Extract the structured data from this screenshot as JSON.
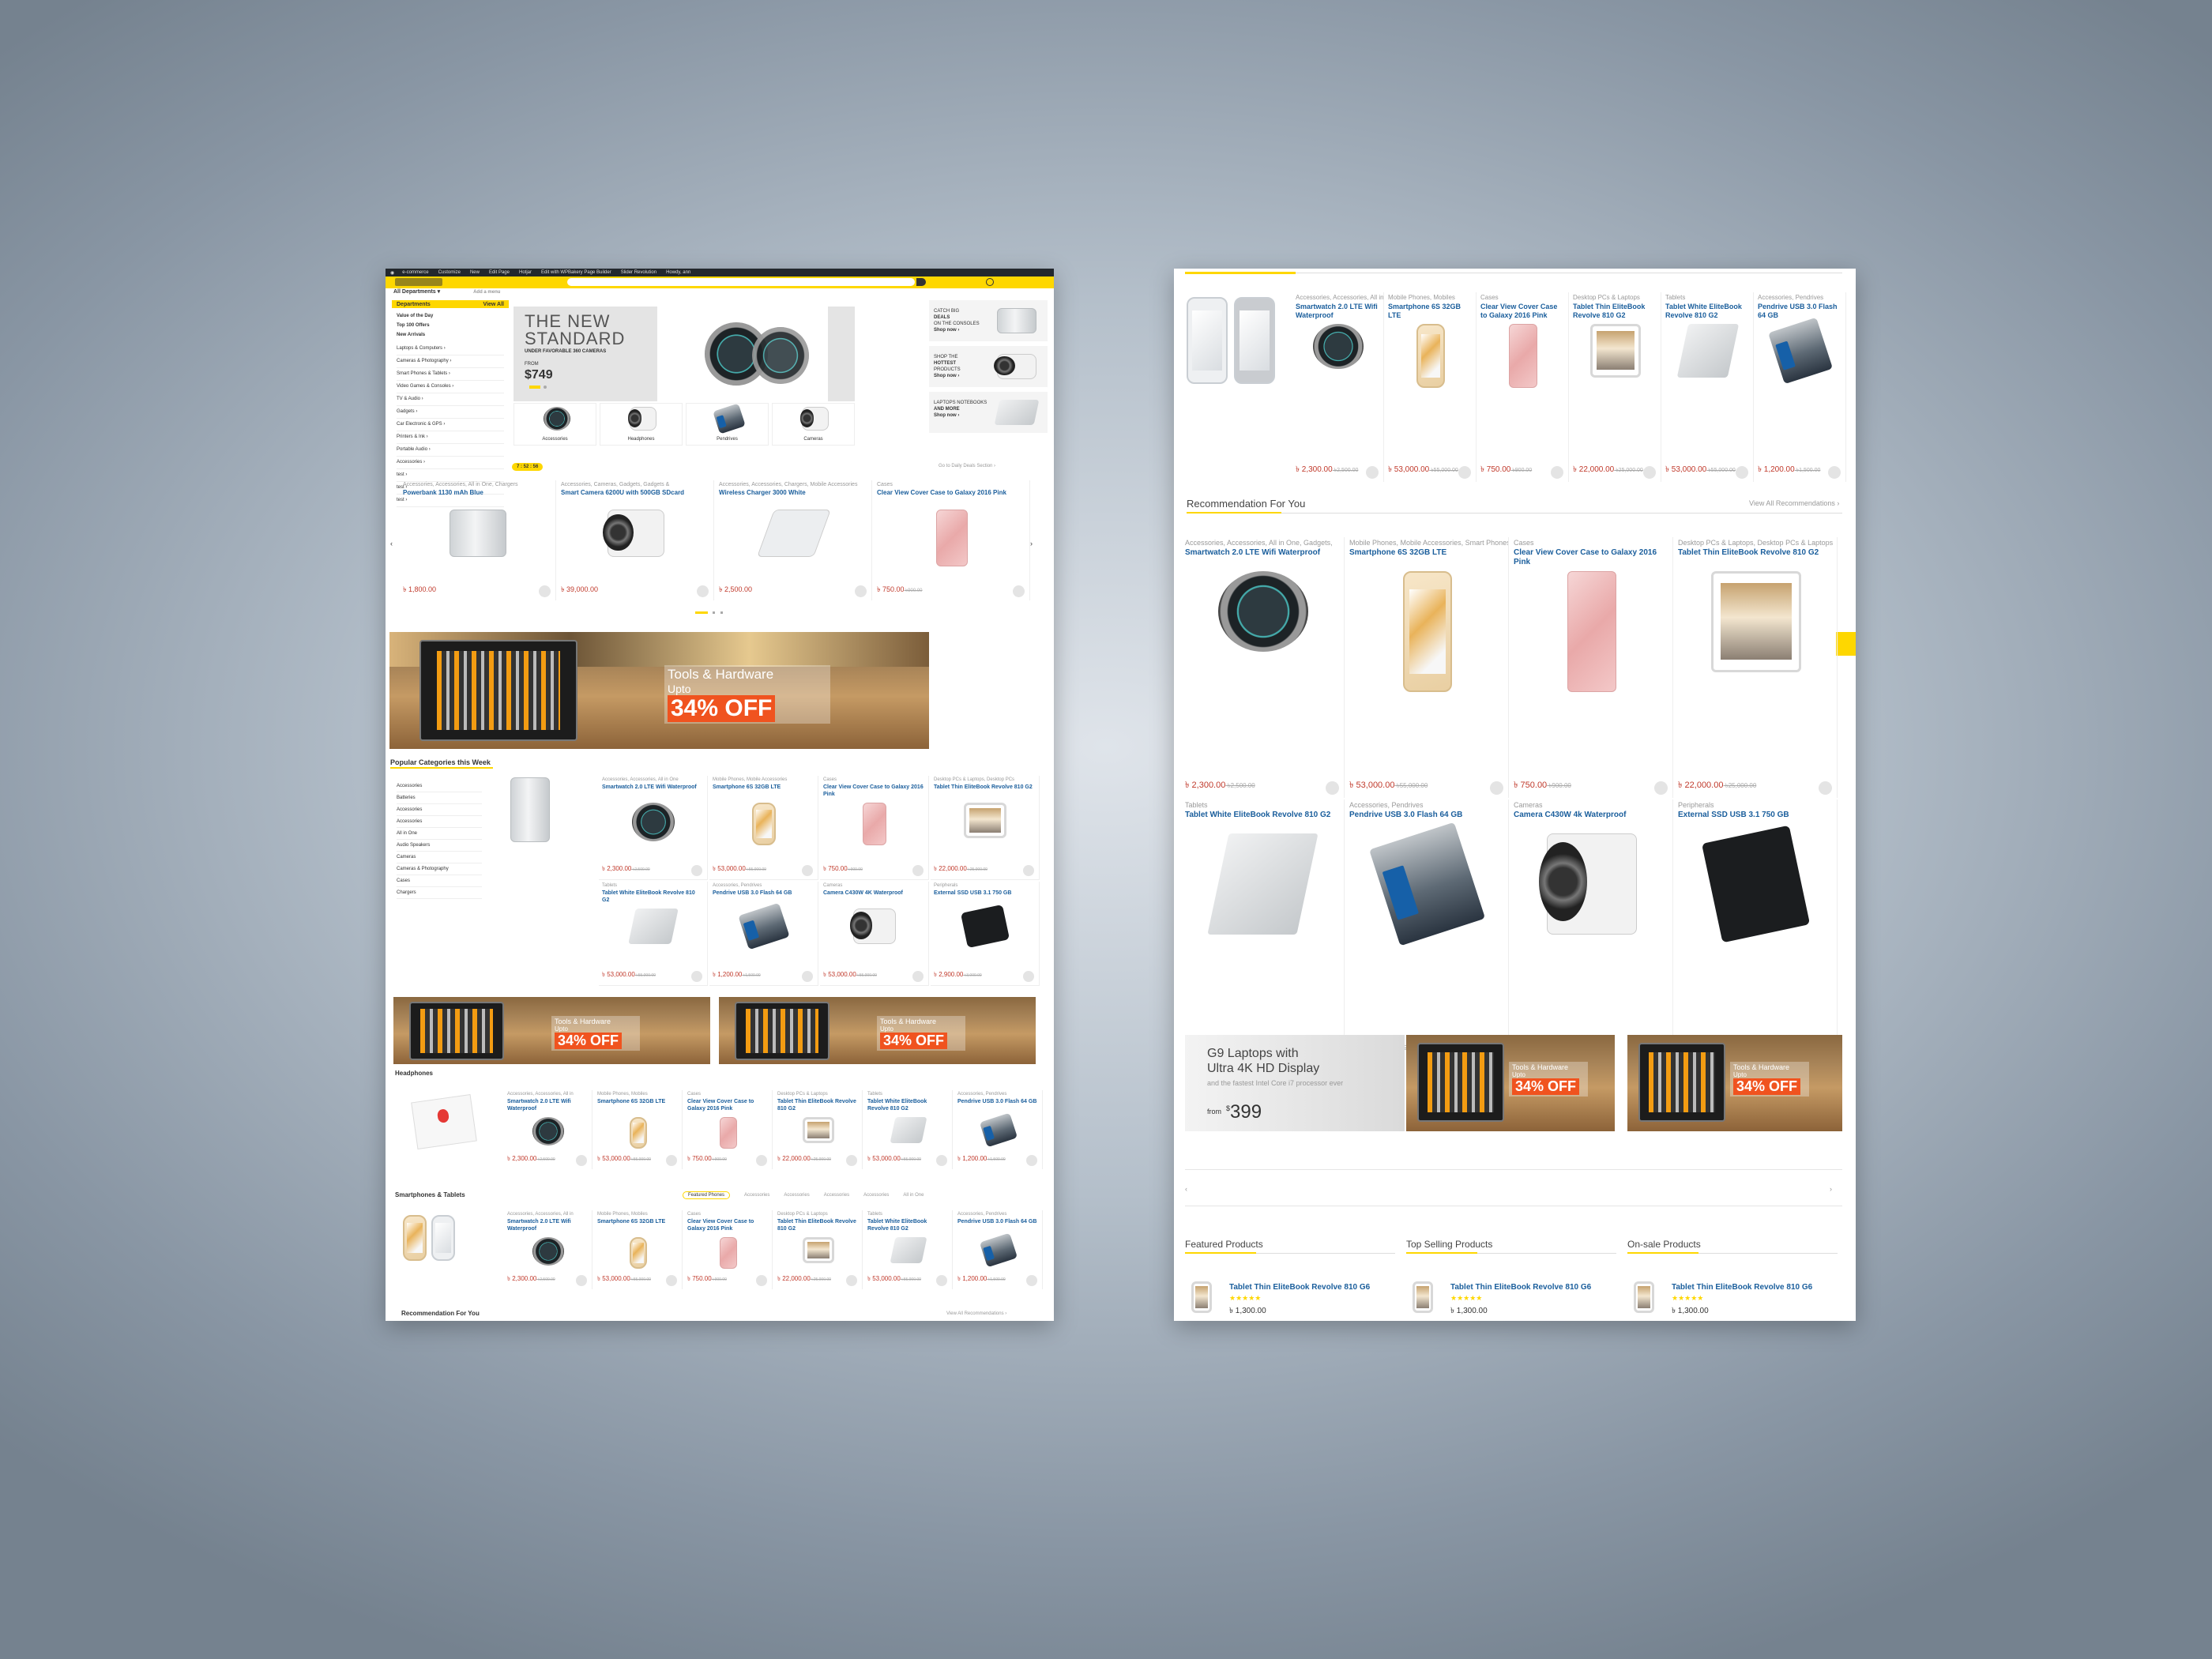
{
  "currency": "৳",
  "p1": {
    "topbar": [
      "e-commerce",
      "Customize",
      "New",
      "Edit Page",
      "Hotjar",
      "Edit with WPBakery Page Builder",
      "Slider Revolution",
      "Howdy, ann"
    ],
    "depts": "All Departments",
    "add_menu": "Add a menu",
    "side_head": "Departments",
    "side_viewall": "View All",
    "side_bold": [
      "Value of the Day",
      "Top 100 Offers",
      "New Arrivals"
    ],
    "side_items": [
      "Laptops & Computers",
      "Cameras & Photography",
      "Smart Phones & Tablets",
      "Video Games & Consoles",
      "TV & Audio",
      "Gadgets",
      "Car Electronic & GPS",
      "Printers & Ink",
      "Portable Audio",
      "Accessories",
      "test",
      "test",
      "test"
    ],
    "hero": {
      "title1": "THE NEW",
      "title2": "STANDARD",
      "sub": "UNDER FAVORABLE 360 CAMERAS",
      "from": "FROM",
      "price": "$749"
    },
    "promo": [
      {
        "l1": "CATCH BIG",
        "l2": "DEALS",
        "l3": "ON THE CONSOLES",
        "shop": "Shop now"
      },
      {
        "l1": "SHOP THE",
        "l2": "HOTTEST",
        "l3": "PRODUCTS",
        "shop": "Shop now"
      },
      {
        "l1": "LAPTOPS NOTEBOOKS",
        "l2": "AND MORE",
        "l3": "",
        "shop": "Shop now"
      }
    ],
    "cats": [
      "Accessories",
      "Headphones",
      "Pendrives",
      "Cameras"
    ],
    "timer": "7 : 52 : 56",
    "deals_link": "Go to Daily Deals Section",
    "deals": [
      {
        "cat": "Accessories, Accessories, All in One, Chargers",
        "name": "Powerbank 1130 mAh Blue",
        "price": "1,800.00",
        "old": "",
        "img": "pbank"
      },
      {
        "cat": "Accessories, Cameras, Gadgets, Gadgets &",
        "name": "Smart Camera 6200U with 500GB SDcard",
        "price": "39,000.00",
        "old": "",
        "img": "camera"
      },
      {
        "cat": "Accessories, Accessories, Chargers, Mobile Accessories",
        "name": "Wireless Charger 3000 White",
        "price": "2,500.00",
        "old": "",
        "img": "wireless"
      },
      {
        "cat": "Cases",
        "name": "Clear View Cover Case to Galaxy 2016 Pink",
        "price": "750.00",
        "old": "900.00",
        "img": "pink"
      }
    ],
    "banner": {
      "title": "Tools & Hardware",
      "upto": "Upto",
      "off": "34% OFF"
    },
    "pop_title": "Popular Categories this Week",
    "pop_cats": [
      "Accessories",
      "Batteries",
      "Accessories",
      "Accessories",
      "All in One",
      "Audio Speakers",
      "Cameras",
      "Cameras & Photography",
      "Cases",
      "Chargers"
    ],
    "pop_grid": [
      {
        "cat": "Accessories, Accessories, All in One",
        "name": "Smartwatch 2.0 LTE Wifi Waterproof",
        "price": "2,300.00",
        "old": "2,500.00",
        "img": "watch"
      },
      {
        "cat": "Mobile Phones, Mobile Accessories",
        "name": "Smartphone 6S 32GB LTE",
        "price": "53,000.00",
        "old": "55,000.00",
        "img": "iphone"
      },
      {
        "cat": "Cases",
        "name": "Clear View Cover Case to Galaxy 2016 Pink",
        "price": "750.00",
        "old": "900.00",
        "img": "pink"
      },
      {
        "cat": "Desktop PCs & Laptops, Desktop PCs",
        "name": "Tablet Thin EliteBook Revolve 810 G2",
        "price": "22,000.00",
        "old": "25,000.00",
        "img": "tablet"
      },
      {
        "cat": "Tablets",
        "name": "Tablet White EliteBook Revolve 810 G2",
        "price": "53,000.00",
        "old": "55,000.00",
        "img": "laptop"
      },
      {
        "cat": "Accessories, Pendrives",
        "name": "Pendrive USB 3.0 Flash 64 GB",
        "price": "1,200.00",
        "old": "1,500.00",
        "img": "usb"
      },
      {
        "cat": "Cameras",
        "name": "Camera C430W 4K Waterproof",
        "price": "53,000.00",
        "old": "55,000.00",
        "img": "camera"
      },
      {
        "cat": "Peripherals",
        "name": "External SSD USB 3.1 750 GB",
        "price": "2,900.00",
        "old": "3,000.00",
        "img": "hdd"
      }
    ],
    "head_title": "Headphones",
    "row6": [
      {
        "cat": "Accessories, Accessories, All in",
        "name": "Smartwatch 2.0 LTE Wifi Waterproof",
        "price": "2,300.00",
        "old": "2,500.00",
        "img": "watch"
      },
      {
        "cat": "Mobile Phones, Mobiles",
        "name": "Smartphone 6S 32GB LTE",
        "price": "53,000.00",
        "old": "55,000.00",
        "img": "iphone"
      },
      {
        "cat": "Cases",
        "name": "Clear View Cover Case to Galaxy 2016 Pink",
        "price": "750.00",
        "old": "900.00",
        "img": "pink"
      },
      {
        "cat": "Desktop PCs & Laptops",
        "name": "Tablet Thin EliteBook Revolve 810 G2",
        "price": "22,000.00",
        "old": "25,000.00",
        "img": "tablet"
      },
      {
        "cat": "Tablets",
        "name": "Tablet White EliteBook Revolve 810 G2",
        "price": "53,000.00",
        "old": "55,000.00",
        "img": "laptop"
      },
      {
        "cat": "Accessories, Pendrives",
        "name": "Pendrive USB 3.0 Flash 64 GB",
        "price": "1,200.00",
        "old": "1,500.00",
        "img": "usb"
      }
    ],
    "sp_title": "Smartphones & Tablets",
    "sp_tabs": [
      "Featured Phones",
      "Accessories",
      "Accessories",
      "Accessories",
      "Accessories",
      "All in One"
    ],
    "rec_title": "Recommendation For You",
    "rec_link": "View All Recommendations"
  },
  "p2": {
    "top": [
      {
        "cat": "Accessories, Accessories, All in",
        "name": "Smartwatch 2.0 LTE Wifi Waterproof",
        "price": "2,300.00",
        "old": "2,500.00",
        "img": "watch"
      },
      {
        "cat": "Mobile Phones, Mobiles",
        "name": "Smartphone 6S 32GB LTE",
        "price": "53,000.00",
        "old": "55,000.00",
        "img": "iphone"
      },
      {
        "cat": "Cases",
        "name": "Clear View Cover Case to Galaxy 2016 Pink",
        "price": "750.00",
        "old": "900.00",
        "img": "pink"
      },
      {
        "cat": "Desktop PCs & Laptops",
        "name": "Tablet Thin EliteBook Revolve 810 G2",
        "price": "22,000.00",
        "old": "25,000.00",
        "img": "tablet"
      },
      {
        "cat": "Tablets",
        "name": "Tablet White EliteBook Revolve 810 G2",
        "price": "53,000.00",
        "old": "55,000.00",
        "img": "laptop"
      },
      {
        "cat": "Accessories, Pendrives",
        "name": "Pendrive USB 3.0 Flash 64 GB",
        "price": "1,200.00",
        "old": "1,500.00",
        "img": "usb"
      }
    ],
    "rec_title": "Recommendation For You",
    "rec_link": "View All Recommendations",
    "rec": [
      {
        "cat": "Accessories, Accessories, All in One, Gadgets,",
        "name": "Smartwatch 2.0 LTE Wifi Waterproof",
        "price": "2,300.00",
        "old": "2,500.00",
        "img": "watch"
      },
      {
        "cat": "Mobile Phones, Mobile Accessories, Smart Phones &",
        "name": "Smartphone 6S 32GB LTE",
        "price": "53,000.00",
        "old": "55,000.00",
        "img": "iphone"
      },
      {
        "cat": "Cases",
        "name": "Clear View Cover Case to Galaxy 2016 Pink",
        "price": "750.00",
        "old": "900.00",
        "img": "pink"
      },
      {
        "cat": "Desktop PCs & Laptops, Desktop PCs & Laptops",
        "name": "Tablet Thin EliteBook Revolve 810 G2",
        "price": "22,000.00",
        "old": "25,000.00",
        "img": "tablet"
      },
      {
        "cat": "Tablets",
        "name": "Tablet White EliteBook Revolve 810 G2",
        "price": "53,000.00",
        "old": "55,000.00",
        "img": "laptop"
      },
      {
        "cat": "Accessories, Pendrives",
        "name": "Pendrive USB 3.0 Flash 64 GB",
        "price": "1,200.00",
        "old": "1,500.00",
        "img": "usb"
      },
      {
        "cat": "Cameras",
        "name": "Camera C430W 4k Waterproof",
        "price": "53,000.00",
        "old": "55,000.00",
        "img": "camera"
      },
      {
        "cat": "Peripherals",
        "name": "External SSD USB 3.1 750 GB",
        "price": "2,900.00",
        "old": "3,000.00",
        "img": "hdd"
      }
    ],
    "g9": {
      "l1": "G9 Laptops with",
      "l2": "Ultra 4K HD Display",
      "sub": "and the fastest Intel Core i7 processor ever",
      "from": "from",
      "price": "399"
    },
    "cols": [
      {
        "title": "Featured Products",
        "item": "Tablet Thin EliteBook Revolve 810 G6",
        "price": "1,300.00"
      },
      {
        "title": "Top Selling Products",
        "item": "Tablet Thin EliteBook Revolve 810 G6",
        "price": "1,300.00"
      },
      {
        "title": "On-sale Products",
        "item": "Tablet Thin EliteBook Revolve 810 G6",
        "price": "1,300.00"
      }
    ]
  }
}
